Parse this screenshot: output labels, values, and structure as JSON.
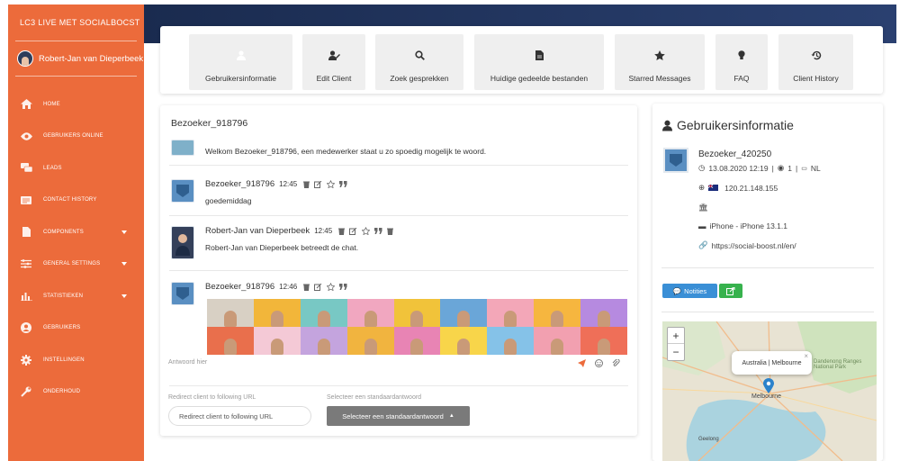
{
  "app": {
    "brand": "LC3   LIVE MET SOCIALBOCST",
    "user_name": "Robert-Jan van Dieperbeek"
  },
  "nav": [
    {
      "label": "HOME",
      "icon": "home-icon"
    },
    {
      "label": "GEBRUIKERS ONLINE",
      "icon": "eye-icon"
    },
    {
      "label": "LEADS",
      "icon": "chat-icon"
    },
    {
      "label": "CONTACT HISTORY",
      "icon": "history-icon"
    },
    {
      "label": "COMPONENTS",
      "icon": "file-icon",
      "caret": true
    },
    {
      "label": "GENERAL SETTINGS",
      "icon": "sliders-icon",
      "caret": true
    },
    {
      "label": "STATISTIEKEN",
      "icon": "chart-icon",
      "caret": true
    },
    {
      "label": "GEBRUIKERS",
      "icon": "user-circle-icon"
    },
    {
      "label": "INSTELLINGEN",
      "icon": "gear-icon"
    },
    {
      "label": "ONDERHOUD",
      "icon": "wrench-icon"
    }
  ],
  "tabs": [
    {
      "label": "Gebruikersinformatie",
      "icon": "user-icon",
      "active": true
    },
    {
      "label": "Edit Client",
      "icon": "user-edit-icon"
    },
    {
      "label": "Zoek gesprekken",
      "icon": "search-icon"
    },
    {
      "label": "Huidige gedeelde bestanden",
      "icon": "file-icon"
    },
    {
      "label": "Starred Messages",
      "icon": "star-icon"
    },
    {
      "label": "FAQ",
      "icon": "lightbulb-icon"
    },
    {
      "label": "Client History",
      "icon": "history-icon"
    }
  ],
  "chat": {
    "title": "Bezoeker_918796",
    "welcome": "Welkom Bezoeker_918796, een medewerker staat u zo spoedig mogelijk te woord.",
    "messages": [
      {
        "name": "Bezoeker_918796",
        "time": "12:45",
        "text": "goedemiddag"
      },
      {
        "name": "Robert-Jan van Dieperbeek",
        "time": "12:45",
        "text": "Robert-Jan van Dieperbeek betreedt de chat."
      },
      {
        "name": "Bezoeker_918796",
        "time": "12:46",
        "text": ""
      }
    ],
    "reply_placeholder": "Antwoord hier",
    "redirect_label": "Redirect client to following URL",
    "redirect_placeholder": "Redirect client to following URL",
    "canned_label": "Selecteer een standaardantwoord",
    "canned_value": "Selecteer een standaardantwoord"
  },
  "info": {
    "title": "Gebruikersinformatie",
    "visitor": "Bezoeker_420250",
    "date": "13.08.2020 12:19",
    "views": "1",
    "lang": "NL",
    "ip": "120.21.148.155",
    "device": "iPhone - iPhone 13.1.1",
    "url": "https://social-boost.nl/en/",
    "notes_label": "Notities"
  },
  "map": {
    "zoom_in": "+",
    "zoom_out": "−",
    "popup": "Australia | Melbourne",
    "city": "Melbourne",
    "region": "Dandenong Ranges National Park",
    "place": "Geelong",
    "close": "×"
  },
  "colors": {
    "accent": "#ec6b3b",
    "header": "#1a2b4f",
    "notes": "#3a8fd6",
    "share": "#37b24d"
  }
}
